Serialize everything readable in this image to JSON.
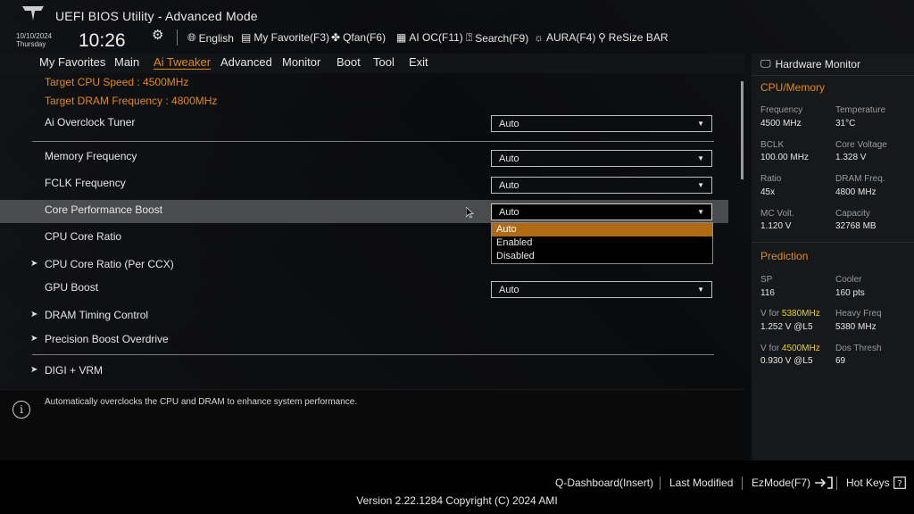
{
  "header": {
    "title": "UEFI BIOS Utility - Advanced Mode",
    "date": "10/10/2024",
    "weekday": "Thursday",
    "time": "10:26",
    "tools": [
      {
        "label": "English",
        "icon": "globe-icon"
      },
      {
        "label": "My Favorite(F3)",
        "icon": "favorite-icon"
      },
      {
        "label": "Qfan(F6)",
        "icon": "fan-icon"
      },
      {
        "label": "AI OC(F11)",
        "icon": "ai-oc-icon"
      },
      {
        "label": "Search(F9)",
        "icon": "search-icon"
      },
      {
        "label": "AURA(F4)",
        "icon": "aura-icon"
      },
      {
        "label": "ReSize BAR",
        "icon": "resize-bar-icon"
      }
    ]
  },
  "nav": {
    "tabs": [
      "My Favorites",
      "Main",
      "Ai Tweaker",
      "Advanced",
      "Monitor",
      "Boot",
      "Tool",
      "Exit"
    ],
    "active": "Ai Tweaker"
  },
  "settings": {
    "target_cpu": "Target CPU Speed : 4500MHz",
    "target_dram": "Target DRAM Frequency : 4800MHz",
    "rows": [
      {
        "label": "Ai Overclock Tuner",
        "value": "Auto"
      },
      {
        "label": "Memory Frequency",
        "value": "Auto"
      },
      {
        "label": "FCLK Frequency",
        "value": "Auto"
      },
      {
        "label": "Core Performance Boost",
        "value": "Auto"
      },
      {
        "label": "CPU Core Ratio"
      },
      {
        "label": "CPU Core Ratio (Per CCX)"
      },
      {
        "label": "GPU Boost",
        "value": "Auto"
      },
      {
        "label": "DRAM Timing Control"
      },
      {
        "label": "Precision Boost Overdrive"
      },
      {
        "label": "DIGI + VRM"
      }
    ],
    "dropdown_options": [
      "Auto",
      "Enabled",
      "Disabled"
    ],
    "highlighted_option": "Auto"
  },
  "help": {
    "text": "Automatically overclocks the CPU and DRAM to enhance system performance."
  },
  "hw_monitor": {
    "title": "Hardware Monitor",
    "cpu_memory": {
      "section": "CPU/Memory",
      "frequency_label": "Frequency",
      "frequency": "4500 MHz",
      "temperature_label": "Temperature",
      "temperature": "31°C",
      "bclk_label": "BCLK",
      "bclk": "100.00 MHz",
      "core_voltage_label": "Core Voltage",
      "core_voltage": "1.328 V",
      "ratio_label": "Ratio",
      "ratio": "45x",
      "dram_freq_label": "DRAM Freq.",
      "dram_freq": "4800 MHz",
      "mc_volt_label": "MC Volt.",
      "mc_volt": "1.120 V",
      "capacity_label": "Capacity",
      "capacity": "32768 MB"
    },
    "prediction": {
      "section": "Prediction",
      "sp_label": "SP",
      "sp": "116",
      "cooler_label": "Cooler",
      "cooler": "160 pts",
      "v_for_label": "V for",
      "v1_freq": "5380MHz",
      "v1_value": "1.252 V @L5",
      "heavy_freq_label": "Heavy Freq",
      "heavy_freq": "5380 MHz",
      "v2_freq": "4500MHz",
      "v2_value": "0.930 V @L5",
      "dos_thresh_label": "Dos Thresh",
      "dos_thresh": "69"
    }
  },
  "footer": {
    "qdashboard": "Q-Dashboard(Insert)",
    "last_modified": "Last Modified",
    "ezmode": "EzMode(F7)",
    "hotkeys": "Hot Keys",
    "version": "Version 2.22.1284 Copyright (C) 2024 AMI"
  },
  "colors": {
    "accent": "#e08a1f",
    "highlight_option": "#b06a14",
    "prediction_freq": "#e8d21a"
  }
}
